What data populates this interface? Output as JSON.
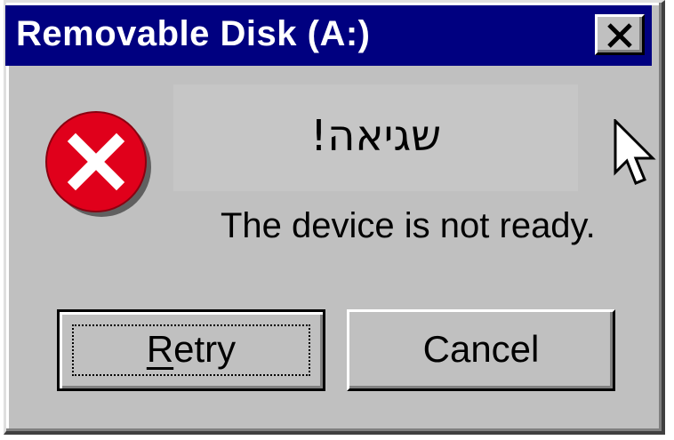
{
  "window": {
    "title": "Removable Disk (A:)",
    "close_icon": "close-icon"
  },
  "dialog": {
    "icon": "error-icon",
    "heading": "שגיאה!",
    "message": "The device is not ready."
  },
  "buttons": {
    "retry_mnemonic": "R",
    "retry_rest": "etry",
    "cancel_label": "Cancel"
  },
  "pointer": {
    "icon": "mouse-pointer-icon"
  },
  "colors": {
    "titlebar": "#000080",
    "face": "#c0c0c0",
    "error_red": "#e0001b"
  }
}
